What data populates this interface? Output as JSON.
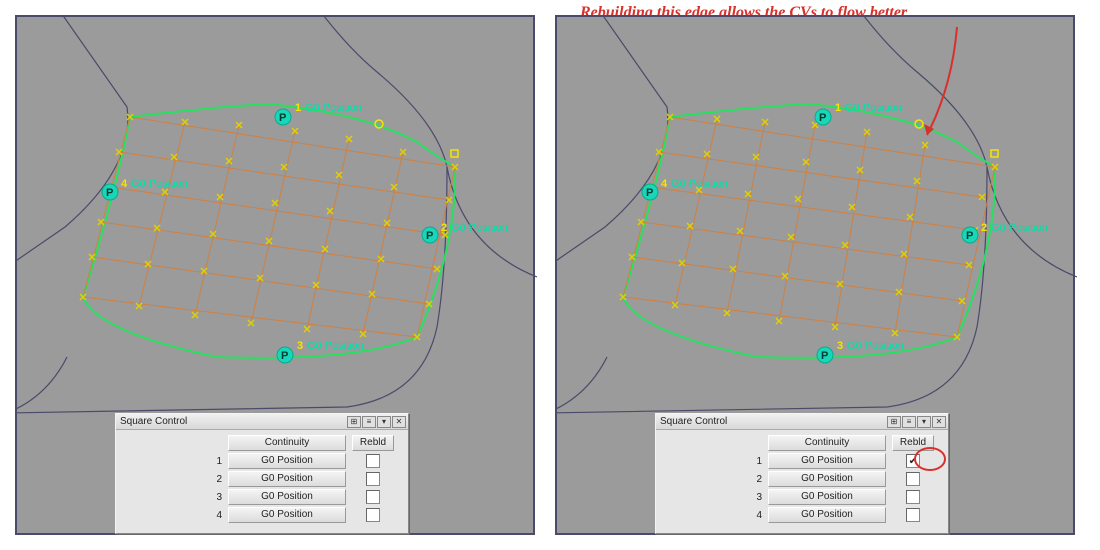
{
  "annotation": "Rebuilding this edge allows the CVs to flow better",
  "labels": {
    "edge1": {
      "num": "1",
      "text": "G0 Position"
    },
    "edge2": {
      "num": "2",
      "text": "G0 Position"
    },
    "edge3": {
      "num": "3",
      "text": "G0 Position"
    },
    "edge4": {
      "num": "4",
      "text": "G0 Position"
    },
    "p_glyph": "P"
  },
  "dialog": {
    "title": "Square Control",
    "header_continuity": "Continuity",
    "header_rebld": "Rebld",
    "rows": [
      {
        "num": "1",
        "cont": "G0 Position",
        "rebld_checked": false
      },
      {
        "num": "2",
        "cont": "G0 Position",
        "rebld_checked": false
      },
      {
        "num": "3",
        "cont": "G0 Position",
        "rebld_checked": false
      },
      {
        "num": "4",
        "cont": "G0 Position",
        "rebld_checked": false
      }
    ]
  },
  "dialog_right": {
    "rows": [
      {
        "num": "1",
        "cont": "G0 Position",
        "rebld_checked": true
      },
      {
        "num": "2",
        "cont": "G0 Position",
        "rebld_checked": false
      },
      {
        "num": "3",
        "cont": "G0 Position",
        "rebld_checked": false
      },
      {
        "num": "4",
        "cont": "G0 Position",
        "rebld_checked": false
      }
    ]
  },
  "title_icons": {
    "expand": "⊞",
    "menu": "≡",
    "dropdown": "▾",
    "close": "✕"
  },
  "check_glyph": "✔"
}
